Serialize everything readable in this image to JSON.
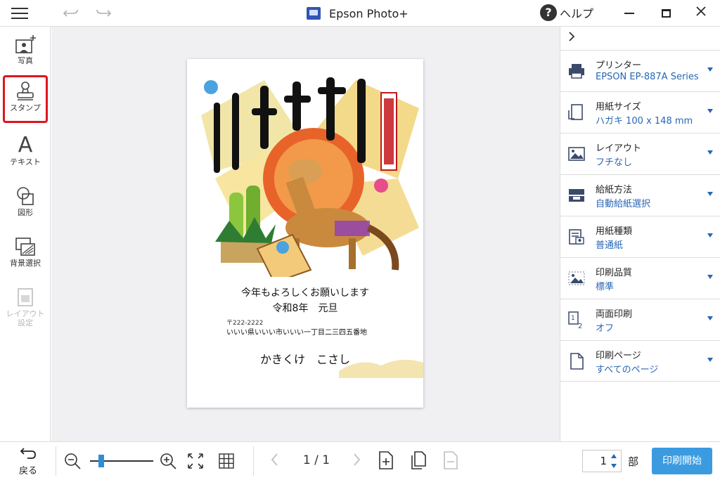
{
  "window": {
    "title": "Epson Photo+",
    "help_label": "ヘルプ",
    "help_glyph": "?"
  },
  "left_tools": [
    {
      "label": "写真"
    },
    {
      "label": "スタンプ"
    },
    {
      "label": "テキスト",
      "glyph": "A"
    },
    {
      "label": "図形"
    },
    {
      "label": "背景選択"
    },
    {
      "label": "レイアウト",
      "label2": "設定"
    }
  ],
  "postcard": {
    "message1": "今年もよろしくお願いします",
    "message2": "令和8年　元旦",
    "postal_code": "〒222-2222",
    "address": "いいい県いいい市いいい一丁目二三四五番地",
    "name": "かきくけ　こさし"
  },
  "settings": [
    {
      "label": "プリンター",
      "value": "EPSON EP-887A Series"
    },
    {
      "label": "用紙サイズ",
      "value": "ハガキ 100 x 148 mm"
    },
    {
      "label": "レイアウト",
      "value": "フチなし"
    },
    {
      "label": "給紙方法",
      "value": "自動給紙選択"
    },
    {
      "label": "用紙種類",
      "value": "普通紙"
    },
    {
      "label": "印刷品質",
      "value": "標準"
    },
    {
      "label": "両面印刷",
      "value": "オフ"
    },
    {
      "label": "印刷ページ",
      "value": "すべてのページ"
    }
  ],
  "bottom": {
    "back_label": "戻る",
    "page_indicator": "1 / 1",
    "copies": "1",
    "copies_unit": "部",
    "print_label": "印刷開始"
  },
  "colors": {
    "accent_blue": "#2766b5",
    "print_button": "#3a9be0",
    "highlight_red": "#e0141e"
  }
}
